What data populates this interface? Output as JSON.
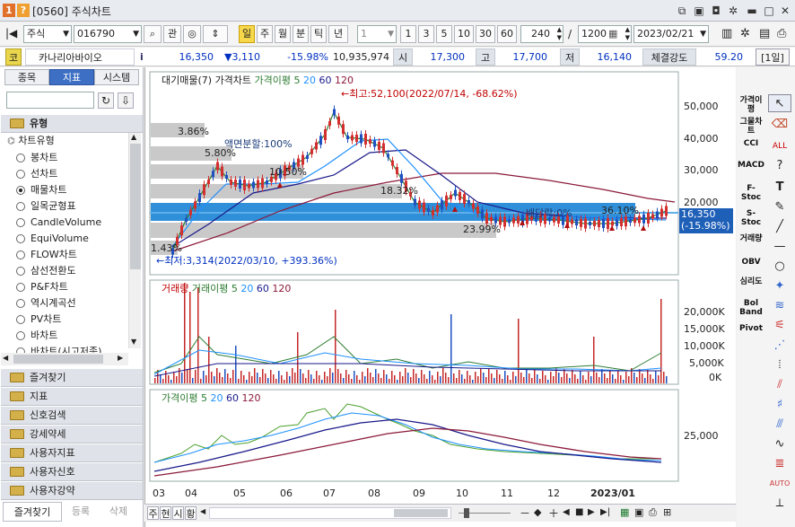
{
  "window": {
    "badge1": "1",
    "badge2": "?",
    "title": "[0560] 주식차트"
  },
  "toolbar": {
    "market": "주식",
    "code": "016790",
    "btn_rel": "관",
    "periods": [
      "일",
      "주",
      "월",
      "분",
      "틱",
      "년"
    ],
    "count_box": "1",
    "counts": [
      "1",
      "3",
      "5",
      "10",
      "30",
      "60"
    ],
    "range_a": "240",
    "range_sep": "/",
    "range_b": "1200",
    "date": "2023/02/21"
  },
  "quote": {
    "code_label": "코",
    "name": "카나리아바이오",
    "info": "i",
    "price": "16,350",
    "change": "▼3,110",
    "rate": "-15.98%",
    "volume": "10,935,974",
    "open_label": "시",
    "open": "17,300",
    "high_label": "고",
    "high": "17,700",
    "low_label": "저",
    "low": "16,140",
    "strength_label": "체결강도",
    "strength": "59.20",
    "period_tag": "[1일]"
  },
  "left": {
    "tabs": [
      "종목",
      "지표",
      "시스템"
    ],
    "group_main": "유형",
    "tree_root": "차트유형",
    "items": [
      {
        "label": "봉차트",
        "on": false
      },
      {
        "label": "선차트",
        "on": false
      },
      {
        "label": "매물차트",
        "on": true
      },
      {
        "label": "일목균형표",
        "on": false
      },
      {
        "label": "CandleVolume",
        "on": false
      },
      {
        "label": "EquiVolume",
        "on": false
      },
      {
        "label": "FLOW차트",
        "on": false
      },
      {
        "label": "삼선전환도",
        "on": false
      },
      {
        "label": "P&F차트",
        "on": false
      },
      {
        "label": "역시계곡선",
        "on": false
      },
      {
        "label": "PV차트",
        "on": false
      },
      {
        "label": "바차트",
        "on": false
      },
      {
        "label": "바차트(시고저종)",
        "on": false
      }
    ],
    "groups": [
      "즐겨찾기",
      "지표",
      "신호검색",
      "강세약세",
      "사용자지표",
      "사용자신호",
      "사용자강약"
    ],
    "bottom_tabs": [
      "즐겨찾기",
      "등록",
      "삭제"
    ]
  },
  "chart": {
    "price_legend": [
      "대기매물(7)",
      "가격차트",
      "가격이평 5",
      "20",
      "60",
      "120"
    ],
    "high_note": "←최고:52,100(2022/07/14, -68.62%)",
    "low_note": "←최저:3,314(2022/03/10, +393.36%)",
    "split_note": "액면분할:100%",
    "div_note": "배당락:0%",
    "pct_labels": [
      "3.86%",
      "5.80%",
      "10.50%",
      "18.32%",
      "36.10%",
      "23.99%",
      "1.43%"
    ],
    "price_axis": [
      "50,000",
      "40,000",
      "30,000",
      "20,000"
    ],
    "last_price": "16,350",
    "last_rate": "(-15.98%)",
    "vol_legend": [
      "거래량",
      "거래이평 5",
      "20",
      "60",
      "120"
    ],
    "vol_axis": [
      "20,000K",
      "15,000K",
      "10,000K",
      "5,000K",
      "0K"
    ],
    "ma_legend": [
      "가격이평 5",
      "20",
      "60",
      "120"
    ],
    "ma_axis": [
      "25,000"
    ],
    "x_axis": [
      "03",
      "04",
      "05",
      "06",
      "07",
      "08",
      "09",
      "10",
      "11",
      "12",
      "2023/01"
    ]
  },
  "right_tools": [
    "가격이평",
    "그물차트",
    "CCI",
    "MACD",
    "F-Stoc",
    "S-Stoc",
    "거래량",
    "OBV",
    "심리도",
    "Bol Band",
    "Pivot"
  ],
  "bottom": {
    "tabs": [
      "주",
      "현",
      "시",
      "황"
    ]
  }
}
